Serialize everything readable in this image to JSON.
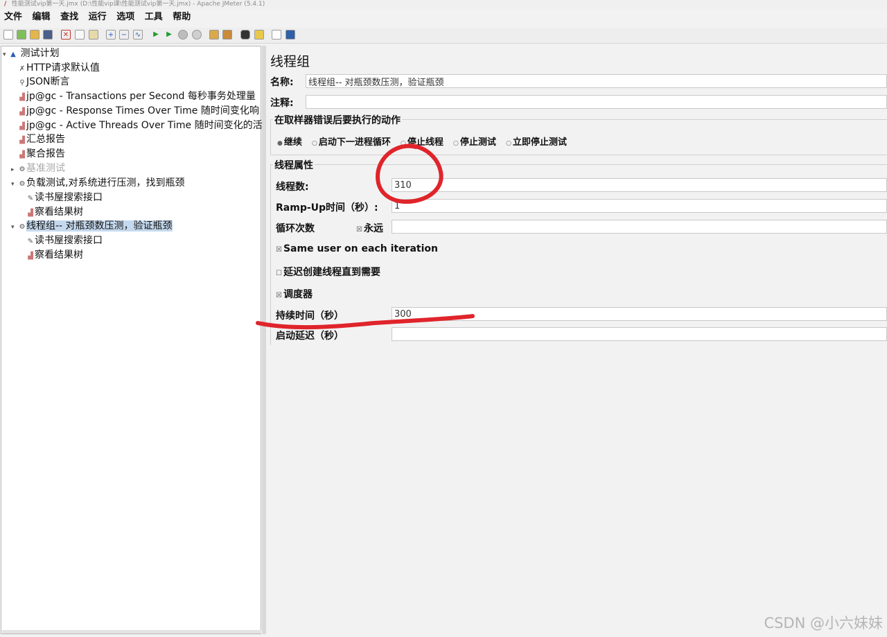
{
  "window": {
    "title": "性能测试vip第一天.jmx (D:\\性能vip课\\性能测试vip第一天.jmx) - Apache JMeter (5.4.1)"
  },
  "menu": [
    "文件",
    "编辑",
    "查找",
    "运行",
    "选项",
    "工具",
    "帮助"
  ],
  "tree": {
    "root": "测试计划",
    "items": [
      {
        "label": "HTTP请求默认值",
        "icon": "wrench-icon"
      },
      {
        "label": "JSON断言",
        "icon": "magnifier-icon"
      },
      {
        "label": "jp@gc - Transactions per Second 每秒事务处理量",
        "icon": "graph-icon"
      },
      {
        "label": "jp@gc - Response Times Over Time 随时间变化响",
        "icon": "graph-icon"
      },
      {
        "label": "jp@gc - Active Threads Over Time 随时间变化的活",
        "icon": "graph-icon"
      },
      {
        "label": "汇总报告",
        "icon": "graph-icon"
      },
      {
        "label": "聚合报告",
        "icon": "graph-icon"
      },
      {
        "label": "基准测试",
        "icon": "gear-icon"
      },
      {
        "label": "负载测试,对系统进行压测，找到瓶颈",
        "icon": "gear-icon"
      },
      {
        "label": "读书屋搜索接口",
        "icon": "pencil-icon"
      },
      {
        "label": "察看结果树",
        "icon": "graph-icon"
      },
      {
        "label": "线程组-- 对瓶颈数压测，验证瓶颈",
        "icon": "gear-icon"
      },
      {
        "label": "读书屋搜索接口",
        "icon": "pencil-icon"
      },
      {
        "label": "察看结果树",
        "icon": "graph-icon"
      }
    ]
  },
  "panel": {
    "title": "线程组",
    "name_label": "名称:",
    "name_value": "线程组-- 对瓶颈数压测，验证瓶颈",
    "comment_label": "注释:",
    "comment_value": "",
    "on_error": {
      "title": "在取样器错误后要执行的动作",
      "options": [
        "继续",
        "启动下一进程循环",
        "停止线程",
        "停止测试",
        "立即停止测试"
      ],
      "selected": "继续"
    },
    "thread_props": {
      "title": "线程属性",
      "threads_label": "线程数:",
      "threads_value": "310",
      "rampup_label": "Ramp-Up时间（秒）:",
      "rampup_value": "1",
      "loop_label": "循环次数",
      "forever_label": "永远",
      "loop_value": "",
      "same_user_label": "Same user on each iteration",
      "delay_label": "延迟创建线程直到需要",
      "scheduler_label": "调度器",
      "duration_label": "持续时间（秒）",
      "duration_value": "300",
      "startup_delay_label": "启动延迟（秒）",
      "startup_delay_value": ""
    }
  },
  "watermark": "CSDN @小六妹妹",
  "colors": {
    "selection": "#c5d9ee",
    "annotation": "#e0242b"
  }
}
